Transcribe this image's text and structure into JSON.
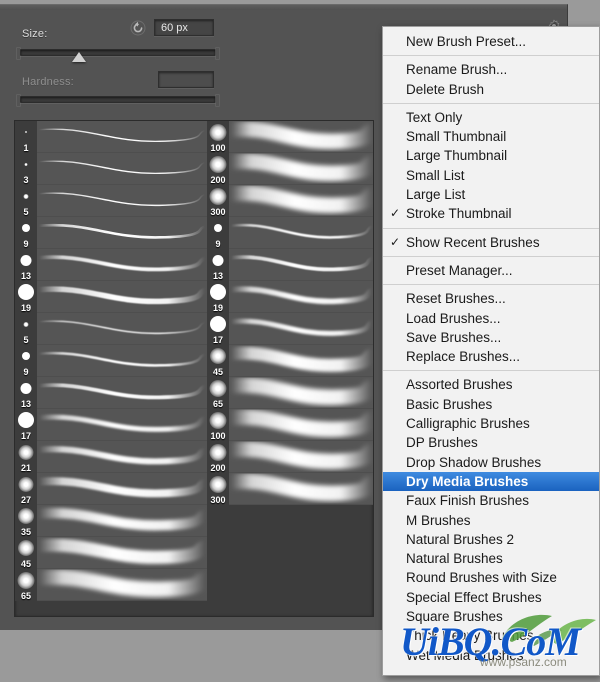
{
  "panel": {
    "size": {
      "label": "Size:",
      "value": "60 px",
      "reset_icon": "reset-circular-arrow-icon",
      "slider_position_pct": 30
    },
    "hardness": {
      "label": "Hardness:",
      "value": "",
      "enabled": false
    },
    "gear_icon": "gear-icon"
  },
  "brush_list": {
    "recent_sizes": [
      "1",
      "3",
      "5",
      "9",
      "13",
      "19"
    ],
    "column_left": [
      "1",
      "3",
      "5",
      "9",
      "13",
      "19",
      "5",
      "9",
      "13",
      "17",
      "21",
      "27",
      "35",
      "45",
      "65"
    ],
    "column_middle": [
      "100",
      "200",
      "300",
      "9",
      "13",
      "19",
      "17",
      "45",
      "65",
      "100",
      "200",
      "300"
    ]
  },
  "menu": {
    "items": [
      {
        "label": "New Brush Preset...",
        "checked": false,
        "selected": false
      },
      {
        "separator": true
      },
      {
        "label": "Rename Brush...",
        "checked": false,
        "selected": false
      },
      {
        "label": "Delete Brush",
        "checked": false,
        "selected": false
      },
      {
        "separator": true
      },
      {
        "label": "Text Only",
        "checked": false,
        "selected": false
      },
      {
        "label": "Small Thumbnail",
        "checked": false,
        "selected": false
      },
      {
        "label": "Large Thumbnail",
        "checked": false,
        "selected": false
      },
      {
        "label": "Small List",
        "checked": false,
        "selected": false
      },
      {
        "label": "Large List",
        "checked": false,
        "selected": false
      },
      {
        "label": "Stroke Thumbnail",
        "checked": true,
        "selected": false
      },
      {
        "separator": true
      },
      {
        "label": "Show Recent Brushes",
        "checked": true,
        "selected": false
      },
      {
        "separator": true
      },
      {
        "label": "Preset Manager...",
        "checked": false,
        "selected": false
      },
      {
        "separator": true
      },
      {
        "label": "Reset Brushes...",
        "checked": false,
        "selected": false
      },
      {
        "label": "Load Brushes...",
        "checked": false,
        "selected": false
      },
      {
        "label": "Save Brushes...",
        "checked": false,
        "selected": false
      },
      {
        "label": "Replace Brushes...",
        "checked": false,
        "selected": false
      },
      {
        "separator": true
      },
      {
        "label": "Assorted Brushes",
        "checked": false,
        "selected": false
      },
      {
        "label": "Basic Brushes",
        "checked": false,
        "selected": false
      },
      {
        "label": "Calligraphic Brushes",
        "checked": false,
        "selected": false
      },
      {
        "label": "DP Brushes",
        "checked": false,
        "selected": false
      },
      {
        "label": "Drop Shadow Brushes",
        "checked": false,
        "selected": false
      },
      {
        "label": "Dry Media Brushes",
        "checked": false,
        "selected": true
      },
      {
        "label": "Faux Finish Brushes",
        "checked": false,
        "selected": false
      },
      {
        "label": "M Brushes",
        "checked": false,
        "selected": false
      },
      {
        "label": "Natural Brushes 2",
        "checked": false,
        "selected": false
      },
      {
        "label": "Natural Brushes",
        "checked": false,
        "selected": false
      },
      {
        "label": "Round Brushes with Size",
        "checked": false,
        "selected": false
      },
      {
        "label": "Special Effect Brushes",
        "checked": false,
        "selected": false
      },
      {
        "label": "Square Brushes",
        "checked": false,
        "selected": false
      },
      {
        "label": "Thick Heavy Brushes",
        "checked": false,
        "selected": false
      },
      {
        "label": "Wet Media Brushes",
        "checked": false,
        "selected": false
      }
    ],
    "check_glyph": "✓",
    "highlight_color": "#1a62bf"
  },
  "watermark": {
    "text": "UiBQ.CoM",
    "subtext": "www.psanz.com",
    "color": "#1158c8"
  }
}
